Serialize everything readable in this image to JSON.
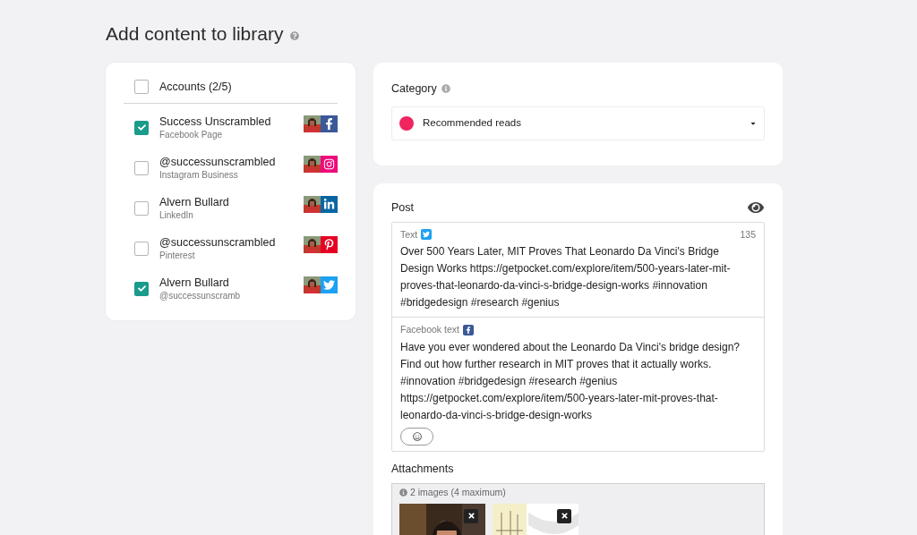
{
  "title": "Add content to library",
  "accounts": {
    "header": "Accounts (2/5)",
    "all_checked": false,
    "items": [
      {
        "name": "Success Unscrambled",
        "type": "Facebook Page",
        "checked": true,
        "kind": "facebook"
      },
      {
        "name": "@successunscrambled",
        "type": "Instagram Business",
        "checked": false,
        "kind": "instagram"
      },
      {
        "name": "Alvern Bullard",
        "type": "LinkedIn",
        "checked": false,
        "kind": "linkedin"
      },
      {
        "name": "@successunscrambled",
        "type": "Pinterest",
        "checked": false,
        "kind": "pinterest"
      },
      {
        "name": "Alvern Bullard",
        "type": "@successunscramb",
        "checked": true,
        "kind": "twitter"
      }
    ]
  },
  "category": {
    "label": "Category",
    "value": "Recommended reads",
    "color": "#f0245f"
  },
  "post": {
    "label": "Post",
    "fields": [
      {
        "label": "Text",
        "kind": "twitter",
        "counter": "135",
        "text": "Over 500 Years Later, MIT Proves That Leonardo Da Vinci's Bridge Design Works https://getpocket.com/explore/item/500-years-later-mit-proves-that-leonardo-da-vinci-s-bridge-design-works #innovation #bridgedesign #research #genius"
      },
      {
        "label": "Facebook text",
        "kind": "facebook",
        "text": "Have you ever wondered about the Leonardo Da Vinci's bridge design? Find out how further research in MIT proves that it actually works. #innovation #bridgedesign #research #genius https://getpocket.com/explore/item/500-years-later-mit-proves-that-leonardo-da-vinci-s-bridge-design-works"
      }
    ],
    "attachments": {
      "label": "Attachments",
      "info": "2 images (4 maximum)"
    }
  }
}
